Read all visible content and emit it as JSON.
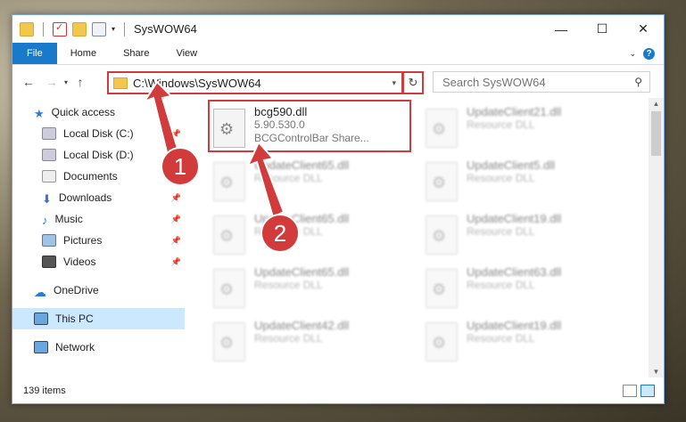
{
  "window": {
    "title": "SysWOW64",
    "minimize": "—",
    "maximize": "☐",
    "close": "✕"
  },
  "ribbon": {
    "tabs": [
      "File",
      "Home",
      "Share",
      "View"
    ]
  },
  "address": {
    "path": "C:\\Windows\\SysWOW64",
    "search_placeholder": "Search SysWOW64"
  },
  "nav_pane": {
    "items": [
      {
        "label": "Quick access",
        "icon": "star-icon",
        "pinned": false
      },
      {
        "label": "Local Disk (C:)",
        "icon": "drive-icon",
        "pinned": true
      },
      {
        "label": "Local Disk (D:)",
        "icon": "drive-icon",
        "pinned": false
      },
      {
        "label": "Documents",
        "icon": "documents-icon",
        "pinned": true
      },
      {
        "label": "Downloads",
        "icon": "downloads-icon",
        "pinned": true
      },
      {
        "label": "Music",
        "icon": "music-icon",
        "pinned": true
      },
      {
        "label": "Pictures",
        "icon": "pictures-icon",
        "pinned": true
      },
      {
        "label": "Videos",
        "icon": "videos-icon",
        "pinned": true
      },
      {
        "label": "OneDrive",
        "icon": "onedrive-icon",
        "pinned": false
      },
      {
        "label": "This PC",
        "icon": "this-pc-icon",
        "pinned": false,
        "selected": true
      },
      {
        "label": "Network",
        "icon": "network-icon",
        "pinned": false
      }
    ]
  },
  "files": [
    {
      "name": "bcg590.dll",
      "line2": "5.90.530.0",
      "line3": "BCGControlBar Share...",
      "highlighted": true
    },
    {
      "name": "UpdateClient21.dll",
      "line2": "Resource DLL"
    },
    {
      "name": "UpdateClient65.dll",
      "line2": "Resource DLL"
    },
    {
      "name": "UpdateClient5.dll",
      "line2": "Resource DLL"
    },
    {
      "name": "UpdateClient65.dll",
      "line2": "Resource DLL"
    },
    {
      "name": "UpdateClient19.dll",
      "line2": "Resource DLL"
    },
    {
      "name": "UpdateClient65.dll",
      "line2": "Resource DLL"
    },
    {
      "name": "UpdateClient63.dll",
      "line2": "Resource DLL"
    },
    {
      "name": "UpdateClient42.dll",
      "line2": "Resource DLL"
    },
    {
      "name": "UpdateClient19.dll",
      "line2": "Resource DLL"
    }
  ],
  "status": {
    "count": "139 items"
  },
  "annotations": {
    "step1": "1",
    "step2": "2",
    "color": "#d23b3b"
  }
}
